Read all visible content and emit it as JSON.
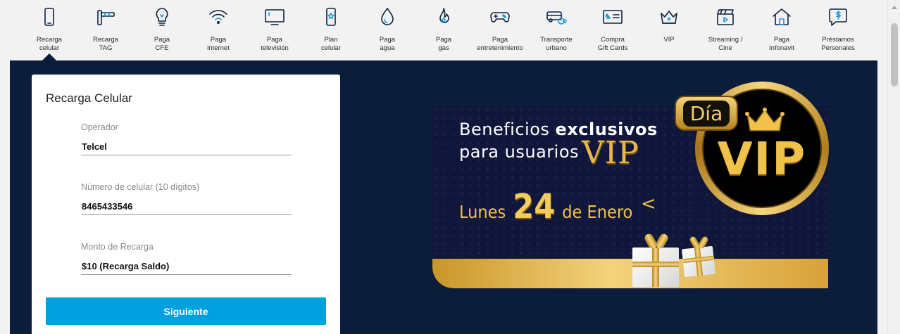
{
  "nav": {
    "items": [
      {
        "label": "Recarga\ncelular",
        "icon": "mobile-phone-icon",
        "active": true
      },
      {
        "label": "Recarga\nTAG",
        "icon": "toll-tag-icon"
      },
      {
        "label": "Paga\nCFE",
        "icon": "light-bulb-icon"
      },
      {
        "label": "Paga\ninternet",
        "icon": "wifi-icon"
      },
      {
        "label": "Paga\ntelevisión",
        "icon": "television-icon"
      },
      {
        "label": "Plan\ncelular",
        "icon": "phone-plan-icon"
      },
      {
        "label": "Paga\nagua",
        "icon": "water-drop-icon"
      },
      {
        "label": "Paga\ngas",
        "icon": "flame-icon"
      },
      {
        "label": "Paga\nentretenimiento",
        "icon": "gamepad-icon"
      },
      {
        "label": "Transporte\nurbano",
        "icon": "bus-icon"
      },
      {
        "label": "Compra\nGift Cards",
        "icon": "gift-card-icon"
      },
      {
        "label": "VIP",
        "icon": "crown-icon"
      },
      {
        "label": "Streaming /\nCine",
        "icon": "clapperboard-icon"
      },
      {
        "label": "Paga\nInfonavit",
        "icon": "house-icon"
      },
      {
        "label": "Préstamos\nPersonales",
        "icon": "money-bubble-icon"
      }
    ]
  },
  "form": {
    "title": "Recarga Celular",
    "operator_label": "Operador",
    "operator_value": "Telcel",
    "phone_label": "Número de celular (10 dígitos)",
    "phone_value": "8465433546",
    "amount_label": "Monto de Recarga",
    "amount_value": "$10 (Recarga Saldo)",
    "submit_label": "Siguiente"
  },
  "banner": {
    "line1_prefix": "Beneficios",
    "line1_bold": "exclusivos",
    "line2": "para usuarios",
    "vip_word": "VIP",
    "date_prefix": "Lunes",
    "date_day": "24",
    "date_suffix": "de Enero",
    "chevron": "<",
    "badge_text": "Día",
    "medal_text": "VIP"
  },
  "colors": {
    "hero_bg": "#0b1d3b",
    "primary_button": "#009fdf",
    "gold": "#f0c24a"
  }
}
